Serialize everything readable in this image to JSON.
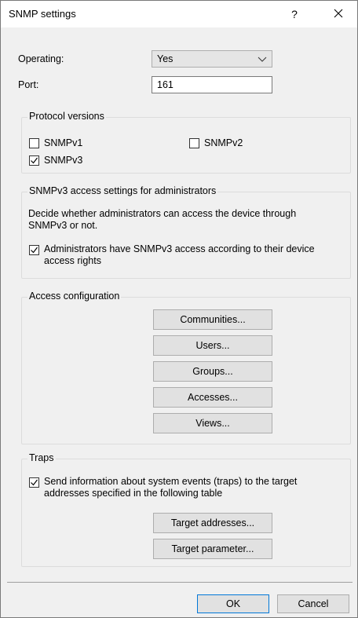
{
  "window": {
    "title": "SNMP settings",
    "help_label": "?"
  },
  "general": {
    "operating_label": "Operating:",
    "operating_value": "Yes",
    "port_label": "Port:",
    "port_value": "161"
  },
  "protocol_versions": {
    "title": "Protocol versions",
    "snmpv1": {
      "label": "SNMPv1",
      "checked": false
    },
    "snmpv2": {
      "label": "SNMPv2",
      "checked": false
    },
    "snmpv3": {
      "label": "SNMPv3",
      "checked": true
    }
  },
  "snmpv3_admin": {
    "title": "SNMPv3 access settings for administrators",
    "description": "Decide whether administrators can access the device through SNMPv3 or not.",
    "checkbox_label": "Administrators have SNMPv3 access according to their device access rights",
    "checked": true
  },
  "access_config": {
    "title": "Access configuration",
    "communities": "Communities...",
    "users": "Users...",
    "groups": "Groups...",
    "accesses": "Accesses...",
    "views": "Views..."
  },
  "traps": {
    "title": "Traps",
    "checkbox_label": "Send information about system events (traps) to the target addresses specified in the following table",
    "checked": true,
    "target_addresses": "Target addresses...",
    "target_parameter": "Target parameter..."
  },
  "footer": {
    "ok": "OK",
    "cancel": "Cancel"
  },
  "icons": {
    "close": "close-icon",
    "dropdown": "chevron-down-icon",
    "check": "checkmark-icon"
  }
}
